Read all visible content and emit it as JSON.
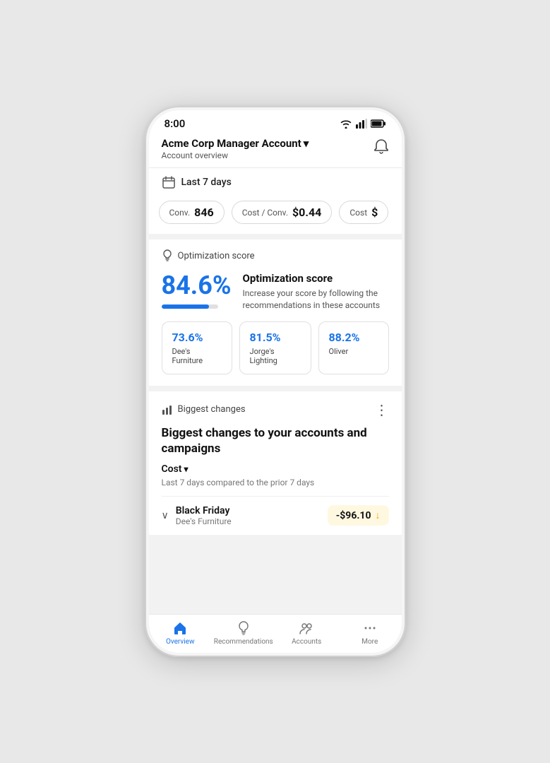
{
  "status": {
    "time": "8:00"
  },
  "header": {
    "account_name": "Acme Corp Manager Account",
    "dropdown_arrow": "▾",
    "subtitle": "Account overview",
    "bell_icon": "🔔"
  },
  "date_range": {
    "label": "Last 7 days",
    "icon": "📅"
  },
  "metrics": [
    {
      "label": "Conv.",
      "value": "846"
    },
    {
      "label": "Cost / Conv.",
      "value": "$0.44"
    },
    {
      "label": "Cost",
      "value": "$"
    }
  ],
  "optimization": {
    "section_label": "Optimization score",
    "score": "84.6%",
    "progress": 84.6,
    "title": "Optimization score",
    "description": "Increase your score by following the recommendations in these accounts",
    "sub_accounts": [
      {
        "score": "73.6%",
        "name": "Dee's Furniture"
      },
      {
        "score": "81.5%",
        "name": "Jorge's Lighting"
      },
      {
        "score": "88.2%",
        "name": "Oliver"
      }
    ]
  },
  "biggest_changes": {
    "section_label": "Biggest changes",
    "title": "Biggest changes to your accounts and campaigns",
    "metric_dropdown": "Cost",
    "comparison": "Last 7 days compared to the prior 7 days",
    "campaigns": [
      {
        "name": "Black Friday",
        "account": "Dee's Furniture",
        "change": "-$96.10",
        "direction": "down"
      }
    ]
  },
  "bottom_nav": [
    {
      "label": "Overview",
      "icon": "🏠",
      "active": true
    },
    {
      "label": "Recommendations",
      "icon": "💡",
      "active": false
    },
    {
      "label": "Accounts",
      "icon": "👥",
      "active": false
    },
    {
      "label": "More",
      "icon": "•••",
      "active": false
    }
  ]
}
